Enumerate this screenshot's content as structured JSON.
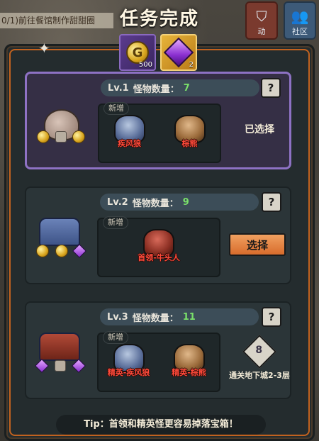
{
  "background": {
    "quest_text": "0/1)前往餐馆制作甜甜圈",
    "btn_activity_label": "动",
    "btn_community_label": "社区"
  },
  "dialog": {
    "title": "任务完成",
    "rewards": [
      {
        "icon": "gold-coin-icon",
        "count": "500"
      },
      {
        "icon": "purple-gem-icon",
        "count": "2"
      }
    ]
  },
  "options": [
    {
      "level": "Lv.1",
      "monster_count_label": "怪物数量：",
      "monster_count": "7",
      "new_tag": "新增",
      "monsters": [
        "疾风狼",
        "棕熊"
      ],
      "status": "已选择",
      "help": "?"
    },
    {
      "level": "Lv.2",
      "monster_count_label": "怪物数量：",
      "monster_count": "9",
      "new_tag": "新增",
      "monsters": [
        "首领-牛头人"
      ],
      "action": "选择",
      "help": "?"
    },
    {
      "level": "Lv.3",
      "monster_count_label": "怪物数量：",
      "monster_count": "11",
      "new_tag": "新增",
      "monsters": [
        "精英-疾风狼",
        "精英-棕熊"
      ],
      "unlock_level": "8",
      "unlock_text": "通关地下城2-3层",
      "help": "?"
    }
  ],
  "tip": "Tip：首领和精英怪更容易掉落宝箱！"
}
